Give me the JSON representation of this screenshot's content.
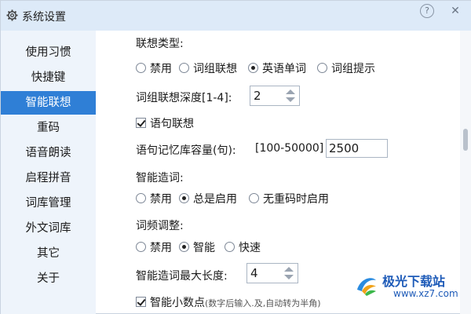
{
  "window": {
    "title": "系统设置",
    "help": "?",
    "close": "✕"
  },
  "sidebar": {
    "items": [
      {
        "label": "使用习惯"
      },
      {
        "label": "快捷键"
      },
      {
        "label": "智能联想",
        "active": true
      },
      {
        "label": "重码"
      },
      {
        "label": "语音朗读"
      },
      {
        "label": "启程拼音"
      },
      {
        "label": "词库管理"
      },
      {
        "label": "外文词库"
      },
      {
        "label": "其它"
      },
      {
        "label": "关于"
      }
    ]
  },
  "main": {
    "assoc_type": {
      "label": "联想类型:",
      "options": [
        "禁用",
        "词组联想",
        "英语单词",
        "词组提示"
      ],
      "selected": "英语单词"
    },
    "phrase_depth": {
      "label": "词组联想深度[1-4]:",
      "value": "2"
    },
    "sentence_assoc": {
      "label": "语句联想",
      "checked": true
    },
    "sentence_capacity": {
      "label": "语句记忆库容量(句):",
      "range": "[100-50000]",
      "value": "2500"
    },
    "smart_word": {
      "label": "智能造词:",
      "options": [
        "禁用",
        "总是启用",
        "无重码时启用"
      ],
      "selected": "总是启用"
    },
    "freq_adjust": {
      "label": "词频调整:",
      "options": [
        "禁用",
        "智能",
        "快速"
      ],
      "selected": "智能"
    },
    "max_word_len": {
      "label": "智能造词最大长度:",
      "value": "4"
    },
    "smart_decimal": {
      "label": "智能小数点",
      "hint": "(数字后输入.及,自动转为半角)",
      "checked": true
    }
  },
  "watermark": {
    "name": "极光下载站",
    "url": "www.xz7.com"
  },
  "colors": {
    "accent": "#2f7fd6",
    "titlebar": "#ddeaf8",
    "sidebar": "#eef4fb"
  }
}
